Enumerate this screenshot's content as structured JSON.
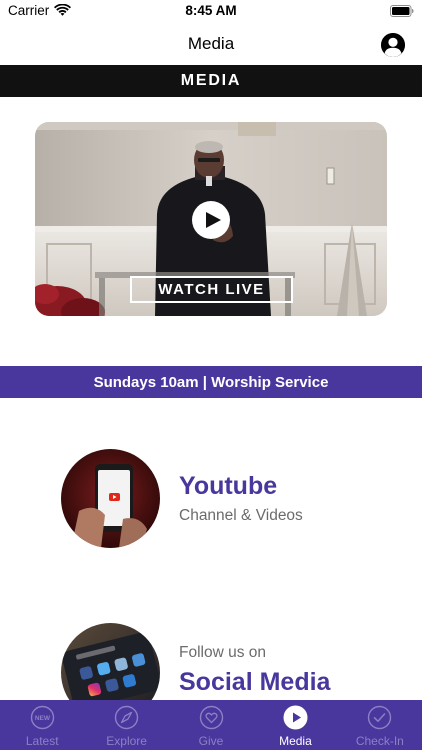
{
  "status_bar": {
    "carrier": "Carrier",
    "time": "8:45 AM"
  },
  "nav": {
    "title": "Media",
    "profile_icon": "person-circle-icon"
  },
  "section_header": "MEDIA",
  "video": {
    "watch_label": "WATCH LIVE",
    "play_icon": "play-icon"
  },
  "banner": "Sundays 10am | Worship Service",
  "rows": [
    {
      "title": "Youtube",
      "subtitle": "Channel & Videos",
      "icon": "youtube-phone-thumbnail"
    },
    {
      "title": "Social Media",
      "subtitle": "Follow us on",
      "icon": "social-apps-thumbnail"
    }
  ],
  "tabs": [
    {
      "label": "Latest",
      "icon": "new-badge-icon",
      "active": false
    },
    {
      "label": "Explore",
      "icon": "compass-icon",
      "active": false
    },
    {
      "label": "Give",
      "icon": "heart-icon",
      "active": false
    },
    {
      "label": "Media",
      "icon": "play-icon",
      "active": true
    },
    {
      "label": "Check-In",
      "icon": "checkmark-icon",
      "active": false
    }
  ],
  "colors": {
    "brand_purple": "#4a379d",
    "header_black": "#111111",
    "inactive_tab": "#8c80c4",
    "subtitle_gray": "#6b6b6b"
  }
}
